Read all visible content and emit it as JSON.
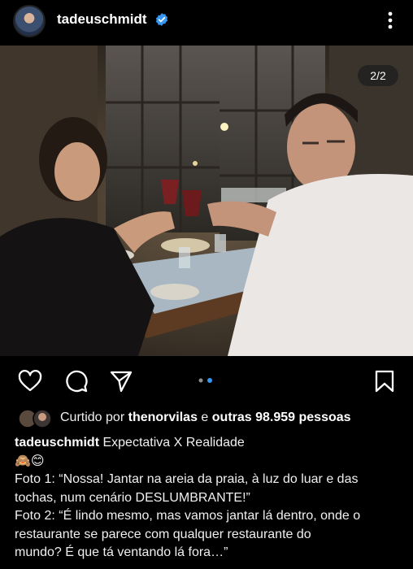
{
  "post": {
    "username": "tadeuschmidt",
    "verified": true,
    "photo_counter": "2/2",
    "carousel": {
      "total": 2,
      "active_index": 1
    }
  },
  "likes": {
    "prefix": "Curtido por",
    "user": "thenorvilas",
    "connector": "e",
    "others": "outras 98.959 pessoas"
  },
  "caption": {
    "username": "tadeuschmidt",
    "title": "Expectativa X Realidade",
    "emojis": "🙈😊",
    "lines": [
      "Foto 1: “Nossa! Jantar na areia da praia, à luz do luar e das",
      "tochas, num cenário DESLUMBRANTE!”",
      "Foto 2: “É lindo mesmo, mas vamos jantar lá dentro, onde o",
      "restaurante se parece com qualquer restaurante do",
      "mundo? É que tá ventando lá fora…”"
    ]
  },
  "icons": [
    "verified-badge-icon",
    "more-options-icon",
    "heart-icon",
    "comment-icon",
    "share-icon",
    "bookmark-icon"
  ],
  "colors": {
    "background": "#000000",
    "verified": "#3897f0",
    "active_dot": "#3897f0",
    "inactive_dot": "#8e8e8e"
  }
}
